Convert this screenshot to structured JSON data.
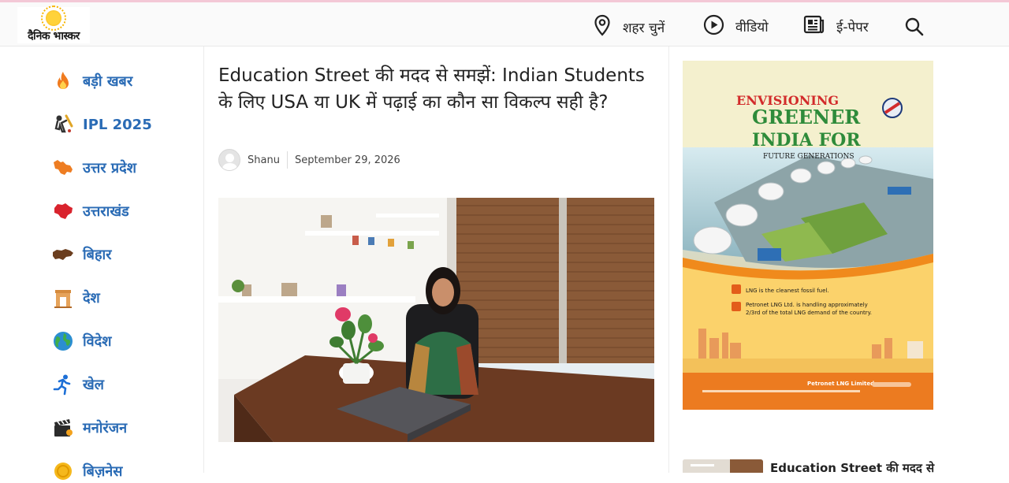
{
  "header": {
    "logo_text": "दैनिक भास्कर",
    "nav": {
      "city": "शहर चुनें",
      "video": "वीडियो",
      "epaper": "ई-पेपर"
    }
  },
  "sidebar": {
    "items": [
      {
        "label": "बड़ी खबर",
        "icon": "fire-icon"
      },
      {
        "label": "IPL 2025",
        "icon": "cricket-icon"
      },
      {
        "label": "उत्तर प्रदेश",
        "icon": "up-map-icon"
      },
      {
        "label": "उत्तराखंड",
        "icon": "uttarakhand-map-icon"
      },
      {
        "label": "बिहार",
        "icon": "bihar-map-icon"
      },
      {
        "label": "देश",
        "icon": "india-gate-icon"
      },
      {
        "label": "विदेश",
        "icon": "globe-icon"
      },
      {
        "label": "खेल",
        "icon": "runner-icon"
      },
      {
        "label": "मनोरंजन",
        "icon": "clapperboard-icon"
      },
      {
        "label": "बिज़नेस",
        "icon": "coin-icon"
      }
    ]
  },
  "article": {
    "headline": "Education Street की मदद से समझें: Indian Students के लिए USA या UK में पढ़ाई का कौन सा विकल्प सही है?",
    "author": "Shanu",
    "date": "September 29, 2026"
  },
  "ad": {
    "line1": "ENVISIONING",
    "line2": "GREENER",
    "line3": "INDIA FOR",
    "line4": "FUTURE GENERATIONS",
    "bullet1": "LNG is the cleanest fossil fuel.",
    "bullet2": "Petronet LNG Ltd. is handling approximately",
    "bullet2b": "2/3rd of the total LNG demand of the country.",
    "company": "Petronet LNG Limited"
  },
  "related": {
    "title": "Education Street की मदद से"
  },
  "colors": {
    "link_blue": "#2a6bb5",
    "ad_red": "#d22b2b",
    "ad_green": "#2e8b3a",
    "ad_orange": "#f08a1c"
  }
}
